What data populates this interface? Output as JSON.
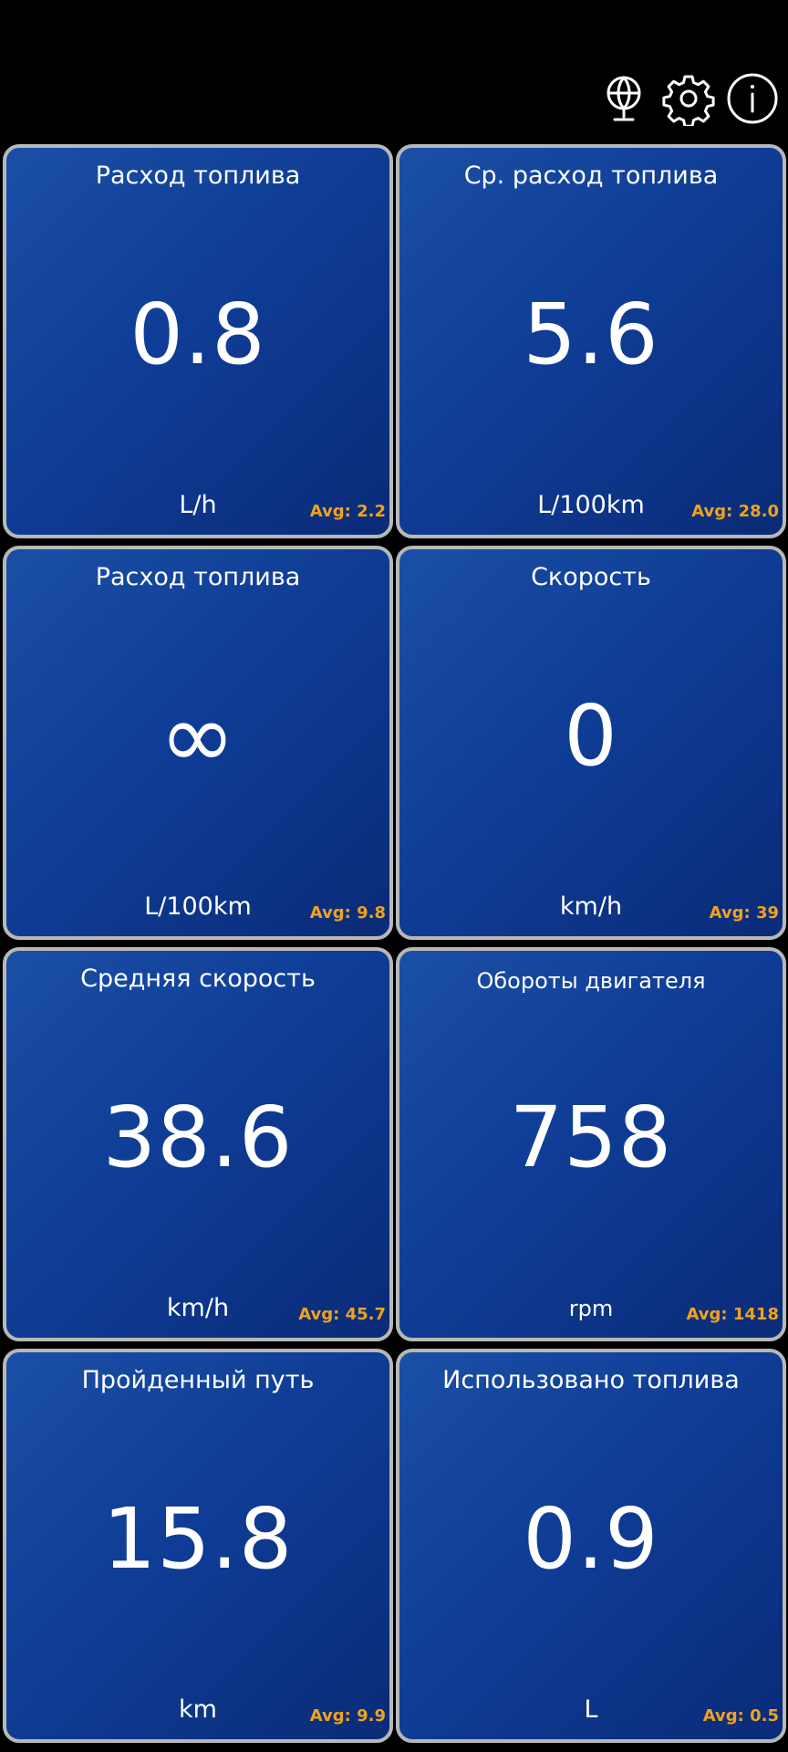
{
  "toolbar": {
    "icons": [
      "globe-icon",
      "gear-icon",
      "info-icon"
    ]
  },
  "colors": {
    "background": "#000000",
    "tile_border": "#b8b8b8",
    "tile_fill": "#0f3d96",
    "avg_text": "#f0a21c",
    "text": "#ffffff"
  },
  "tiles": [
    {
      "title": "Расход топлива",
      "value": "0.8",
      "unit": "L/h",
      "avg": "Avg: 2.2"
    },
    {
      "title": "Ср. расход топлива",
      "value": "5.6",
      "unit": "L/100km",
      "avg": "Avg: 28.0"
    },
    {
      "title": "Расход топлива",
      "value": "∞",
      "unit": "L/100km",
      "avg": "Avg: 9.8"
    },
    {
      "title": "Скорость",
      "value": "0",
      "unit": "km/h",
      "avg": "Avg: 39"
    },
    {
      "title": "Средняя скорость",
      "value": "38.6",
      "unit": "km/h",
      "avg": "Avg: 45.7"
    },
    {
      "title": "Обороты двигателя",
      "value": "758",
      "unit": "rpm",
      "avg": "Avg: 1418"
    },
    {
      "title": "Пройденный путь",
      "value": "15.8",
      "unit": "km",
      "avg": "Avg: 9.9"
    },
    {
      "title": "Использовано топлива",
      "value": "0.9",
      "unit": "L",
      "avg": "Avg: 0.5"
    }
  ]
}
